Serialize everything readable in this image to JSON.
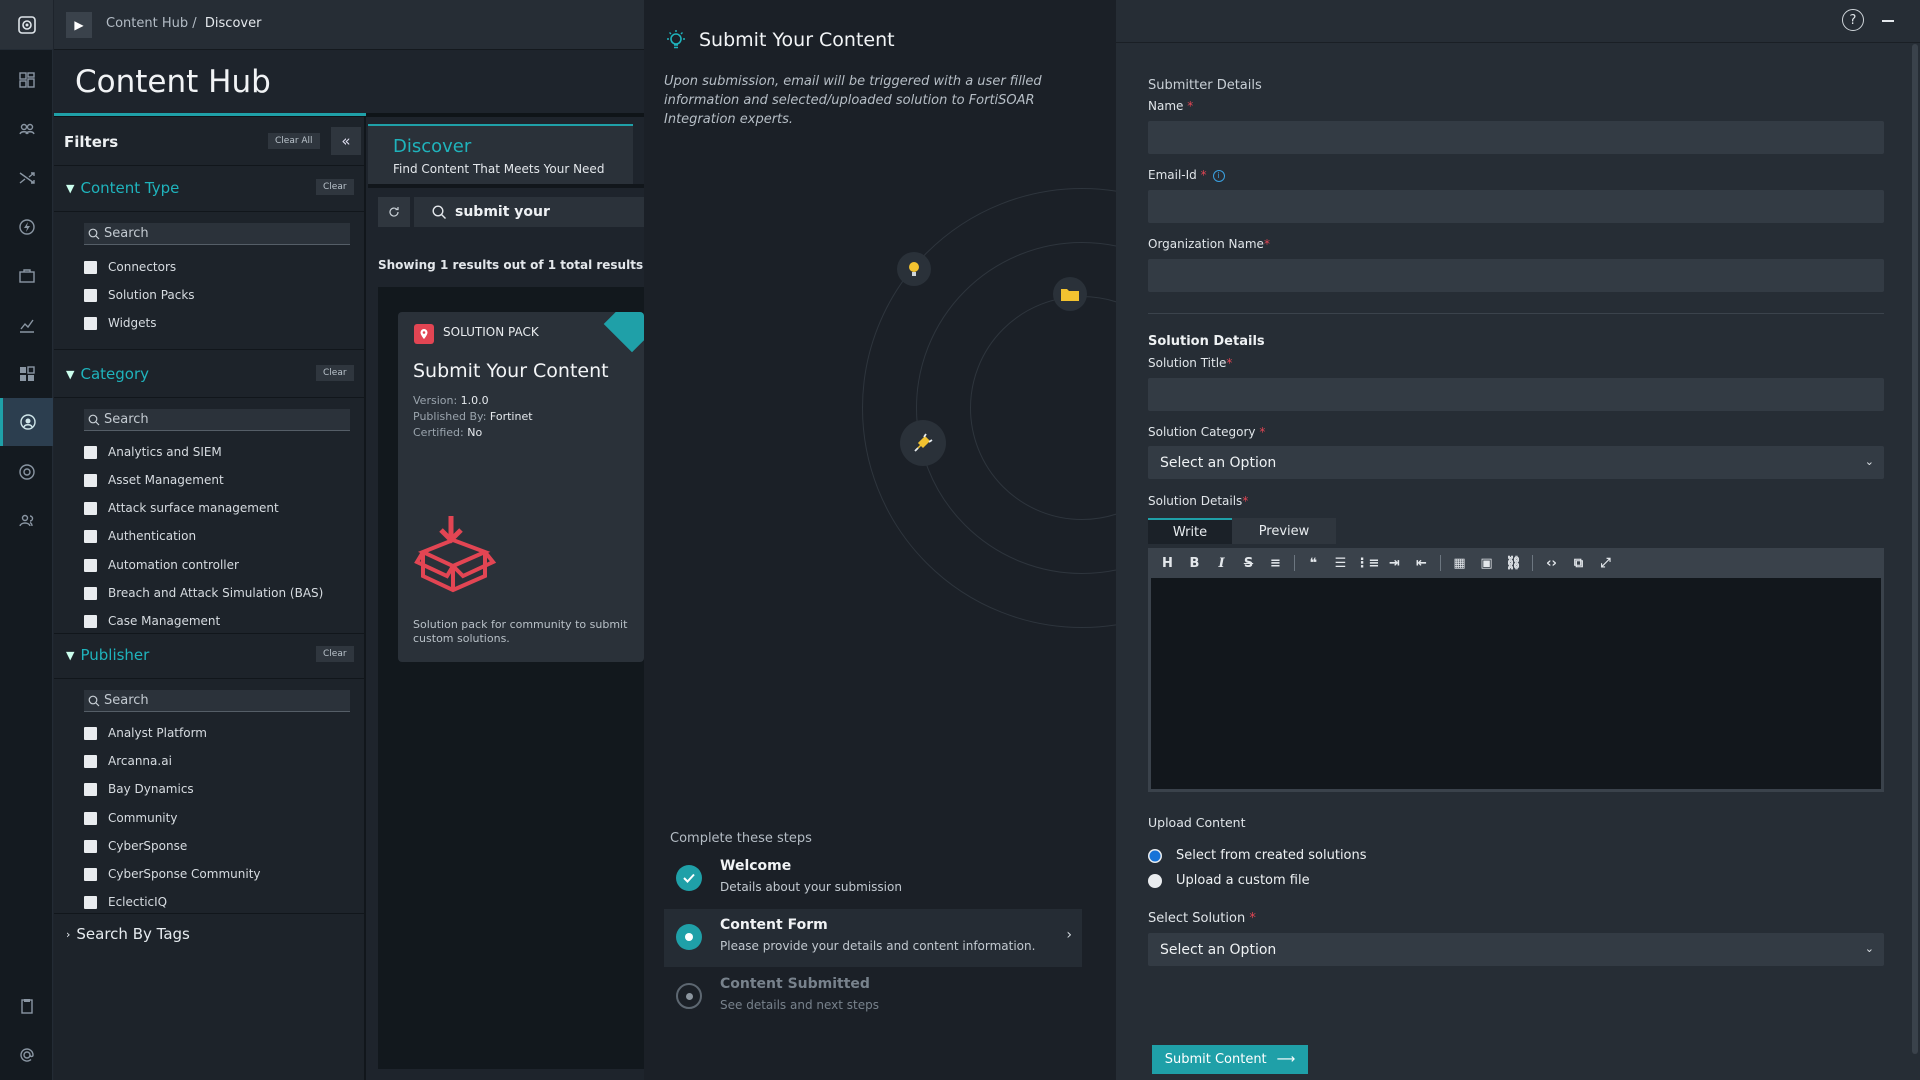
{
  "breadcrumb": {
    "root": "Content Hub",
    "sep": "/",
    "current": "Discover"
  },
  "hub": {
    "title": "Content Hub"
  },
  "filters": {
    "title": "Filters",
    "clear_all": "Clear All",
    "clear": "Clear",
    "search_placeholder": "Search",
    "content_type": {
      "title": "Content Type",
      "items": [
        "Connectors",
        "Solution Packs",
        "Widgets"
      ]
    },
    "category": {
      "title": "Category",
      "items": [
        "Analytics and SIEM",
        "Asset Management",
        "Attack surface management",
        "Authentication",
        "Automation controller",
        "Breach and Attack Simulation (BAS)",
        "Case Management"
      ]
    },
    "publisher": {
      "title": "Publisher",
      "items": [
        "Analyst Platform",
        "Arcanna.ai",
        "Bay Dynamics",
        "Community",
        "CyberSponse",
        "CyberSponse Community",
        "EclecticIQ"
      ]
    },
    "tags": "Search By Tags"
  },
  "discover": {
    "title": "Discover",
    "subtitle": "Find Content That Meets Your Need",
    "search_value": "submit your",
    "showing": "Showing 1 results out of 1 total results"
  },
  "card": {
    "type": "SOLUTION PACK",
    "title": "Submit Your Content",
    "version_label": "Version:",
    "version": "1.0.0",
    "published_label": "Published By:",
    "publisher": "Fortinet",
    "certified_label": "Certified:",
    "certified": "No",
    "description": "Solution pack for community to submit custom solutions."
  },
  "wizard": {
    "title": "Submit Your Content",
    "description": "Upon submission, email will be triggered with a user filled information and selected/uploaded solution to FortiSOAR Integration experts.",
    "steps_title": "Complete these steps",
    "steps": [
      {
        "title": "Welcome",
        "desc": "Details about your submission"
      },
      {
        "title": "Content Form",
        "desc": "Please provide your details and content information."
      },
      {
        "title": "Content Submitted",
        "desc": "See details and next steps"
      }
    ]
  },
  "form": {
    "submitter_group": "Submitter Details",
    "name_label": "Name",
    "email_label": "Email-Id",
    "org_label": "Organization Name",
    "solution_group": "Solution Details",
    "solution_title_label": "Solution Title",
    "solution_category_label": "Solution Category",
    "select_option": "Select an Option",
    "solution_details_label": "Solution Details",
    "tab_write": "Write",
    "tab_preview": "Preview",
    "upload_label": "Upload Content",
    "radio_created": "Select from created solutions",
    "radio_custom": "Upload a custom file",
    "select_solution_label": "Select Solution",
    "submit_label": "Submit Content",
    "required_mark": "*"
  },
  "colors": {
    "accent": "#1fa0a8",
    "required": "#e24553",
    "badge": "#e24553",
    "radio": "#1673d8"
  }
}
